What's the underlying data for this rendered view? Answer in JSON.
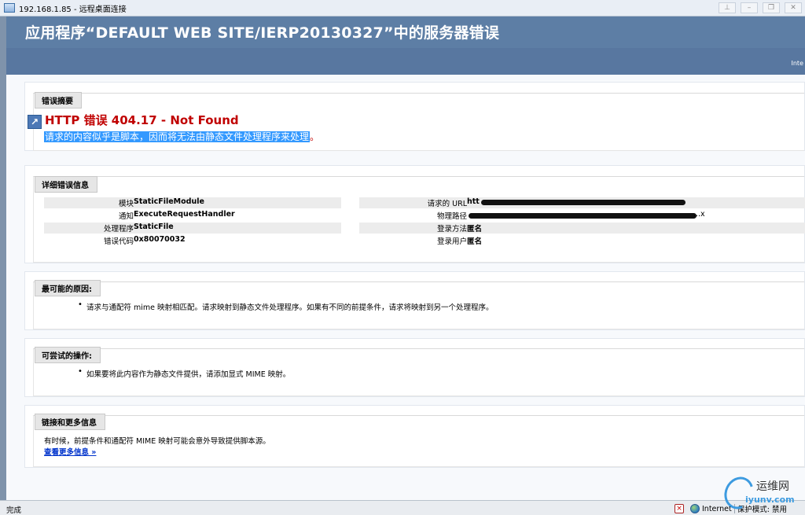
{
  "window": {
    "title": "192.168.1.85 - 远程桌面连接"
  },
  "page": {
    "title": "应用程序“DEFAULT WEB SITE/IERP20130327”中的服务器错误",
    "subheader_text": "Inte"
  },
  "summary": {
    "legend": "错误摘要",
    "heading": "HTTP 错误 404.17 - Not Found",
    "description": "请求的内容似乎是脚本，因而将无法由静态文件处理程序来处理",
    "period": "。"
  },
  "detail": {
    "legend": "详细错误信息",
    "left": [
      {
        "label": "模块",
        "value": "StaticFileModule"
      },
      {
        "label": "通知",
        "value": "ExecuteRequestHandler"
      },
      {
        "label": "处理程序",
        "value": "StaticFile"
      },
      {
        "label": "错误代码",
        "value": "0x80070032"
      }
    ],
    "right": [
      {
        "label": "请求的 URL",
        "value": "htt"
      },
      {
        "label": "物理路径",
        "value": "",
        "tail": "...x"
      },
      {
        "label": "登录方法",
        "value": "匿名"
      },
      {
        "label": "登录用户",
        "value": "匿名"
      }
    ]
  },
  "cause": {
    "legend": "最可能的原因:",
    "items": [
      "请求与通配符 mime 映射相匹配。请求映射到静态文件处理程序。如果有不同的前提条件，请求将映射到另一个处理程序。"
    ]
  },
  "try": {
    "legend": "可尝试的操作:",
    "items": [
      "如果要将此内容作为静态文件提供，请添加显式 MIME 映射。"
    ]
  },
  "links": {
    "legend": "链接和更多信息",
    "text": "有时候，前提条件和通配符 MIME 映射可能会意外导致提供脚本源。",
    "more_link": "查看更多信息 »"
  },
  "status_bar": {
    "left_text": "完成",
    "zone": "Internet",
    "protected_mode": "保护模式: 禁用"
  },
  "watermark": {
    "line1": "运维网",
    "line2": "iyunv.com"
  },
  "colors": {
    "banner": "#5d7ea5",
    "error_red": "#c00000",
    "selection_blue": "#3399ff",
    "link_blue": "#0033cc"
  }
}
